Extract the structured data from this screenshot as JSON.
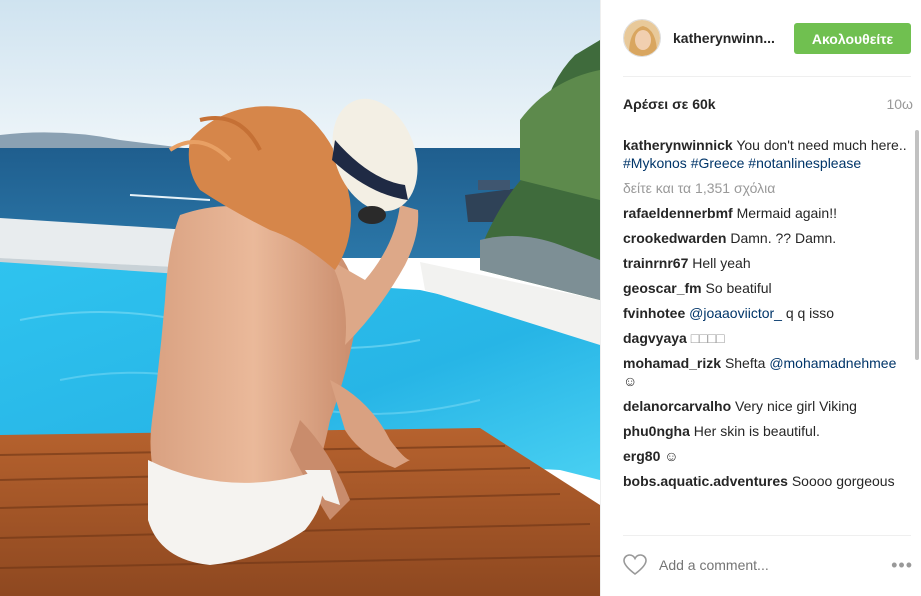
{
  "post": {
    "image_alt": "",
    "header": {
      "username": "katherynwinn...",
      "follow_label": "Ακολουθείτε"
    },
    "likes": "Αρέσει σε 60k",
    "time_ago": "10ω",
    "caption": {
      "user": "katherynwinnick",
      "text": "You don't need much here..",
      "hashtags": [
        "#Mykonos",
        "#Greece",
        "#notanlinesplease"
      ]
    },
    "load_more_label": "δείτε και τα 1,351 σχόλια",
    "comments": [
      {
        "user": "rafaeldennerbmf",
        "text": "Mermaid again!!"
      },
      {
        "user": "crookedwarden",
        "text": "Damn. ?? Damn."
      },
      {
        "user": "trainrnr67",
        "text": "Hell yeah"
      },
      {
        "user": "geoscar_fm",
        "text": "So beatiful"
      },
      {
        "user": "fvinhotee",
        "mention": "@joaaoviictor_",
        "text": "q q isso"
      },
      {
        "user": "dagvyaya",
        "text": "□□□□"
      },
      {
        "user": "mohamad_rizk",
        "text": "Shefta",
        "mention": "@mohamadnehmee",
        "emoji": "☺"
      },
      {
        "user": "delanorcarvalho",
        "text": "Very nice girl Viking"
      },
      {
        "user": "phu0ngha",
        "text": "Her skin is beautiful."
      },
      {
        "user": "erg80",
        "emoji": "☺"
      },
      {
        "user": "bobs.aquatic.adventures",
        "text": "Soooo gorgeous"
      }
    ],
    "add_comment_placeholder": "Add a comment...",
    "more_options": "•••"
  }
}
